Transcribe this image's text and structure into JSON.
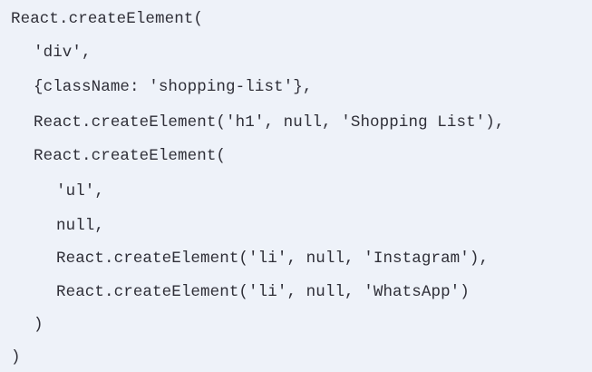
{
  "code": {
    "lines": [
      "React.createElement(",
      "'div',",
      "{className: 'shopping-list'},",
      "React.createElement('h1', null, 'Shopping List'),",
      "React.createElement(",
      "'ul',",
      "null,",
      "React.createElement('li', null, 'Instagram'),",
      "React.createElement('li', null, 'WhatsApp')",
      ")",
      ")"
    ]
  },
  "colors": {
    "background": "#eef2f9",
    "text": "#2f2f38"
  }
}
